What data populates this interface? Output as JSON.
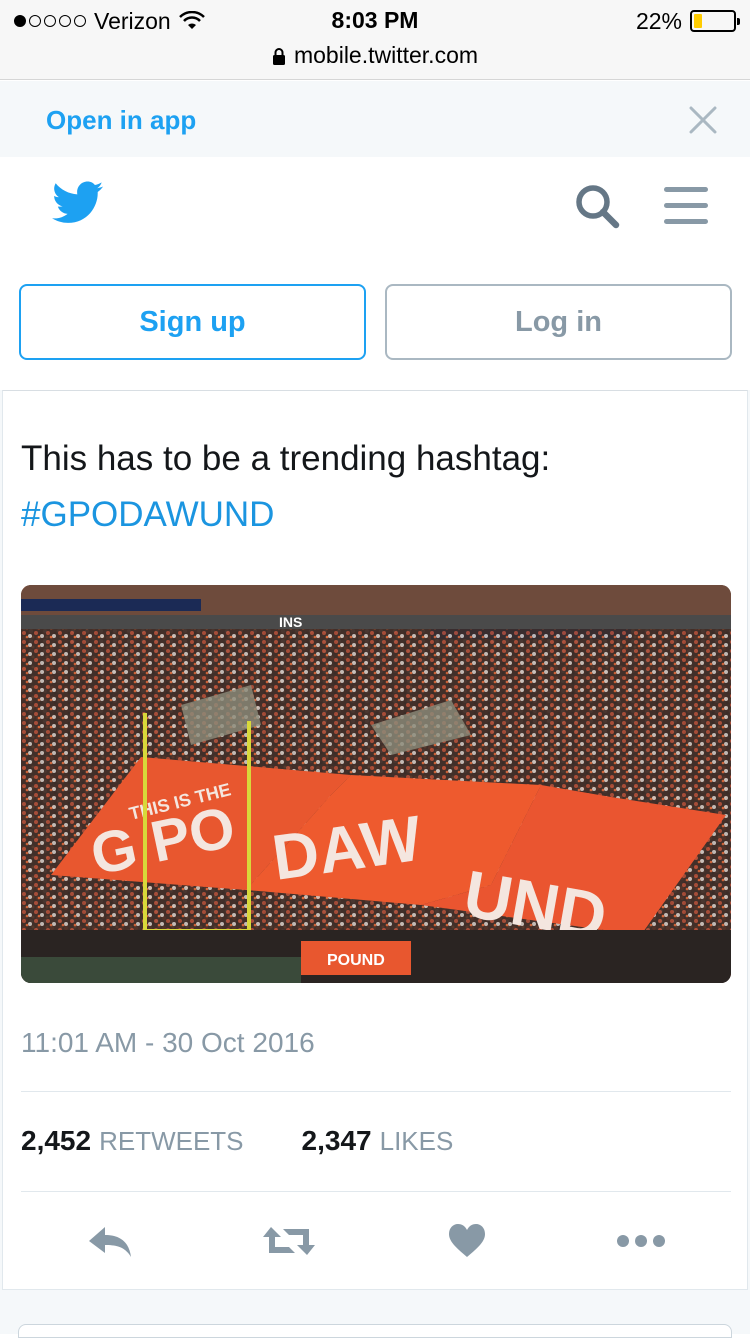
{
  "status_bar": {
    "carrier": "Verizon",
    "time": "8:03 PM",
    "battery": "22%",
    "url": "mobile.twitter.com"
  },
  "banner": {
    "open_in_app": "Open in app"
  },
  "header": {
    "brand_color": "#1da1f2"
  },
  "auth": {
    "signup_label": "Sign up",
    "login_label": "Log in"
  },
  "tweet": {
    "text": "This has to be a trending hashtag:",
    "hashtag": "#GPODAWUND",
    "timestamp": "11:01 AM - 30 Oct 2016",
    "retweets_count": "2,452",
    "retweets_label": "RETWEETS",
    "likes_count": "2,347",
    "likes_label": "LIKES",
    "media": {
      "tarp_text_1": "THIS IS THE",
      "tarp_text_2": "G PO",
      "tarp_text_3": "DAW",
      "tarp_text_4": "UND",
      "scoreboard_text": "INS",
      "sign_text": "POUND"
    }
  },
  "icons": {
    "reply": "reply-icon",
    "retweet": "retweet-icon",
    "like": "heart-icon",
    "more": "more-icon"
  }
}
